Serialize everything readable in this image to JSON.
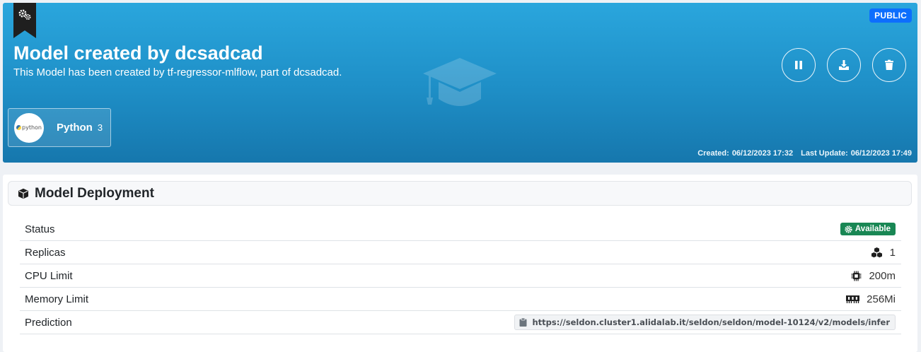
{
  "header": {
    "visibility_badge": "PUBLIC",
    "title": "Model created by dcsadcad",
    "subtitle": "This Model has been created by tf-regressor-mlflow, part of dcsadcad.",
    "actions": [
      {
        "name": "pause",
        "icon": "pause-icon"
      },
      {
        "name": "download",
        "icon": "download-icon"
      },
      {
        "name": "delete",
        "icon": "trash-icon"
      }
    ],
    "technology": {
      "logo_text": "python",
      "name": "Python",
      "version": "3"
    },
    "created_label": "Created:",
    "created_value": "06/12/2023 17:32",
    "updated_label": "Last Update:",
    "updated_value": "06/12/2023 17:49",
    "colors": {
      "gradient_top": "#2aa6dd",
      "gradient_bottom": "#1677ad",
      "badge": "#0d6efd"
    }
  },
  "deployment": {
    "title": "Model Deployment",
    "rows": [
      {
        "label": "Status",
        "value": "Available",
        "icon": "gear-icon"
      },
      {
        "label": "Replicas",
        "value": "1",
        "icon": "cubes-icon"
      },
      {
        "label": "CPU Limit",
        "value": "200m",
        "icon": "microchip-icon"
      },
      {
        "label": "Memory Limit",
        "value": "256Mi",
        "icon": "memory-icon"
      },
      {
        "label": "Prediction",
        "value": "https://seldon.cluster1.alidalab.it/seldon/seldon/model-10124/v2/models/infer",
        "icon": "clipboard-icon"
      }
    ],
    "colors": {
      "status_available": "#198754"
    }
  }
}
